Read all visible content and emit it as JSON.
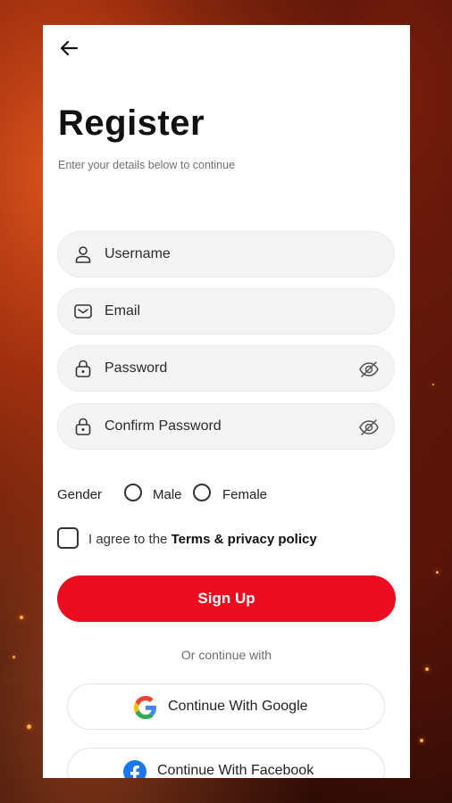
{
  "header": {
    "title": "Register",
    "subtitle": "Enter your details below to continue"
  },
  "fields": {
    "username": {
      "placeholder": "Username",
      "icon": "user-icon"
    },
    "email": {
      "placeholder": "Email",
      "icon": "mail-icon"
    },
    "password": {
      "placeholder": "Password",
      "icon": "lock-icon"
    },
    "confirm_password": {
      "placeholder": "Confirm Password",
      "icon": "lock-icon"
    }
  },
  "gender": {
    "label": "Gender",
    "options": [
      "Male",
      "Female"
    ]
  },
  "agreement": {
    "prefix": "I agree to the ",
    "link": "Terms & privacy policy"
  },
  "actions": {
    "signup": "Sign Up",
    "or_continue": "Or continue with",
    "google": "Continue With Google",
    "facebook": "Continue With Facebook"
  },
  "colors": {
    "accent": "#ec0c1f",
    "field_bg": "#f4f4f4"
  }
}
